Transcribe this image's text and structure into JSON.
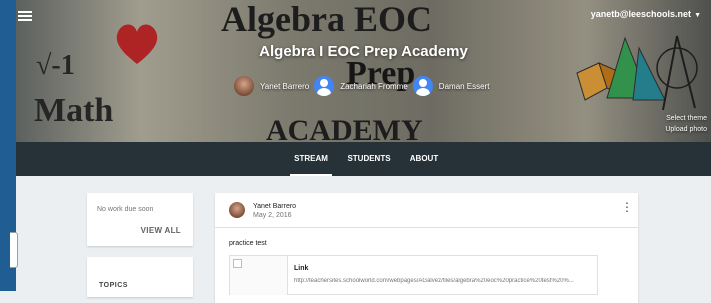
{
  "header": {
    "account_email": "yanetb@leeschools.net",
    "class_title": "Algebra I EOC Prep Academy",
    "teachers": [
      {
        "name": "Yanet Barrero",
        "avatar": "photo"
      },
      {
        "name": "Zachariah Fromme",
        "avatar": "default-person-icon"
      },
      {
        "name": "Daman Essert",
        "avatar": "default-person-icon"
      }
    ],
    "select_theme_label": "Select theme",
    "upload_photo_label": "Upload photo",
    "banner_art": {
      "line1": "Algebra EOC",
      "line2": "Prep",
      "line3": "ACADEMY",
      "math_word": "Math",
      "root_text": "√-1"
    }
  },
  "tabs": [
    {
      "label": "STREAM",
      "active": true
    },
    {
      "label": "STUDENTS",
      "active": false
    },
    {
      "label": "ABOUT",
      "active": false
    }
  ],
  "upcoming": {
    "text": "No work due soon",
    "view_all_label": "VIEW ALL"
  },
  "topics": {
    "title": "TOPICS"
  },
  "post": {
    "author": "Yanet Barrero",
    "date": "May 2, 2016",
    "body": "practice test",
    "attachment": {
      "type_label": "Link",
      "url": "http://teachersites.schoolworld.com/webpages/AGalvez/files/algebra%20eoc%20practice%20test%20%..."
    }
  },
  "colors": {
    "left_rail": "#1f5d93",
    "tab_bar": "#263238",
    "page_bg": "#eceff1",
    "avatar_default": "#4285f4"
  }
}
